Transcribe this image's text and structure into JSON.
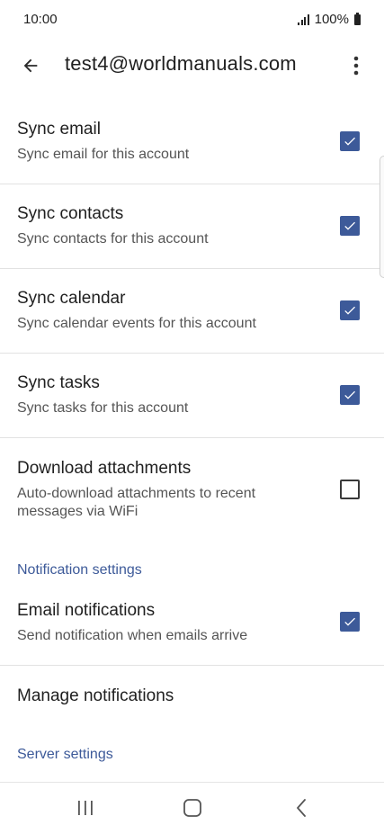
{
  "status_bar": {
    "time": "10:00",
    "battery": "100%"
  },
  "app_bar": {
    "title": "test4@worldmanuals.com",
    "back_icon": "arrow-back-icon",
    "more_icon": "more-vert-icon"
  },
  "settings": [
    {
      "title": "Sync email",
      "subtitle": "Sync email for this account",
      "checked": true
    },
    {
      "title": "Sync contacts",
      "subtitle": "Sync contacts for this account",
      "checked": true
    },
    {
      "title": "Sync calendar",
      "subtitle": "Sync calendar events for this account",
      "checked": true
    },
    {
      "title": "Sync tasks",
      "subtitle": "Sync tasks for this account",
      "checked": true
    },
    {
      "title": "Download attachments",
      "subtitle": "Auto-download attachments to recent messages via WiFi",
      "checked": false
    }
  ],
  "notification_section": {
    "header": "Notification settings",
    "email_notifications": {
      "title": "Email notifications",
      "subtitle": "Send notification when emails arrive",
      "checked": true
    },
    "manage_notifications": {
      "title": "Manage notifications"
    }
  },
  "server_section": {
    "header": "Server settings"
  },
  "colors": {
    "accent": "#3d5a99",
    "checkbox_checked": "#3d5a99"
  },
  "nav_bar": {
    "recent_icon": "recent-apps-icon",
    "home_icon": "home-icon",
    "back_icon": "nav-back-icon"
  }
}
